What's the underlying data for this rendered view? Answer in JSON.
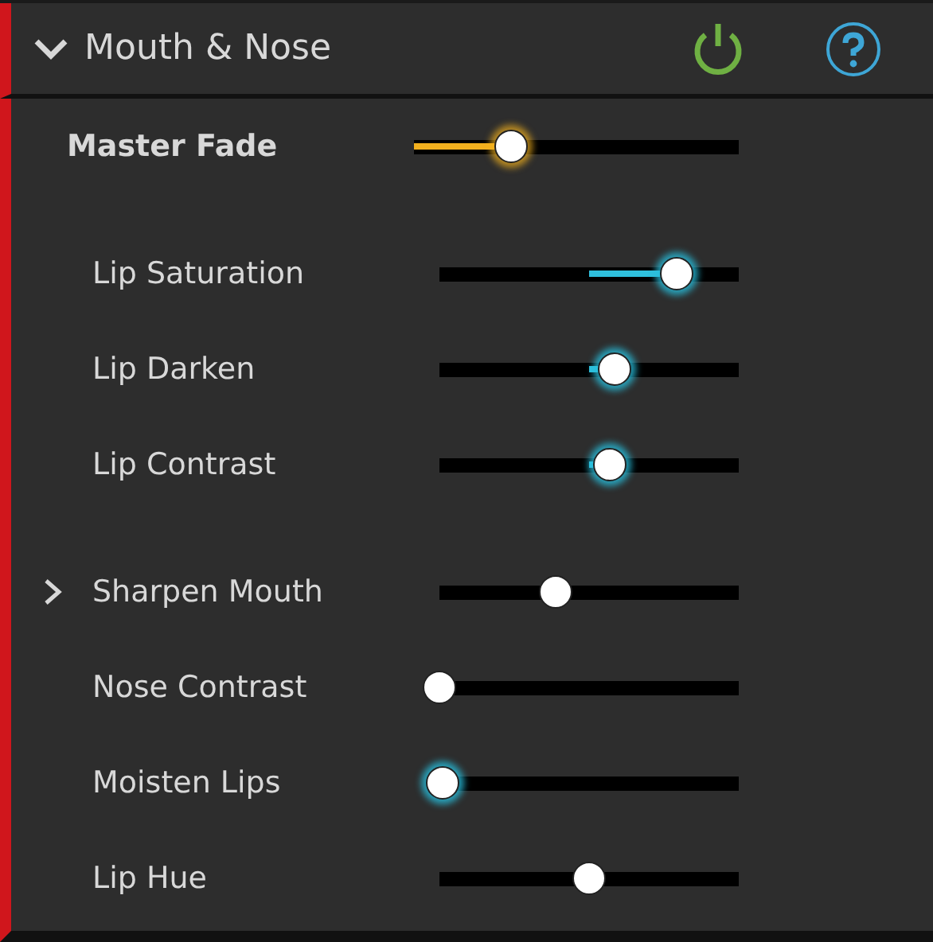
{
  "panel": {
    "title": "Mouth & Nose",
    "expanded": true,
    "enabled": true
  },
  "master": {
    "label": "Master Fade",
    "level": 0.3
  },
  "groups": [
    [
      {
        "label": "Lip Saturation",
        "kind": "centered",
        "level": 0.79,
        "modified": true
      },
      {
        "label": "Lip Darken",
        "kind": "centered",
        "level": 0.585,
        "modified": true
      },
      {
        "label": "Lip Contrast",
        "kind": "centered",
        "level": 0.57,
        "modified": true
      }
    ],
    [
      {
        "label": "Sharpen Mouth",
        "kind": "plain",
        "level": 0.39,
        "modified": false,
        "expanded": false
      },
      {
        "label": "Nose Contrast",
        "kind": "plain",
        "level": 0,
        "modified": false
      },
      {
        "label": "Moisten Lips",
        "kind": "plain",
        "level": 0.01,
        "modified": true
      },
      {
        "label": "Lip Hue",
        "kind": "plain",
        "level": 0.5,
        "modified": false
      }
    ]
  ]
}
